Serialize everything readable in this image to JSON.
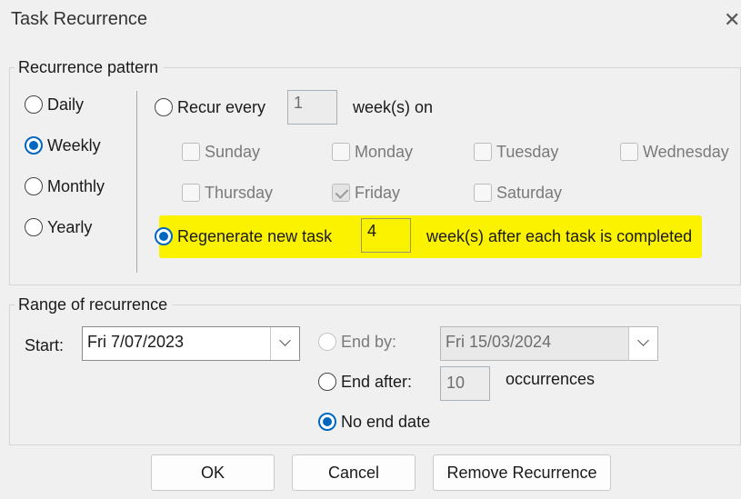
{
  "window": {
    "title": "Task Recurrence",
    "close_glyph": "✕"
  },
  "pattern": {
    "legend": "Recurrence pattern",
    "frequency_options": [
      {
        "label": "Daily",
        "checked": false
      },
      {
        "label": "Weekly",
        "checked": true
      },
      {
        "label": "Monthly",
        "checked": false
      },
      {
        "label": "Yearly",
        "checked": false
      }
    ],
    "recur_every": {
      "label": "Recur every",
      "value": "1",
      "suffix": "week(s) on",
      "checked": false
    },
    "days": [
      {
        "label": "Sunday",
        "checked": false
      },
      {
        "label": "Monday",
        "checked": false
      },
      {
        "label": "Tuesday",
        "checked": false
      },
      {
        "label": "Wednesday",
        "checked": false
      },
      {
        "label": "Thursday",
        "checked": false
      },
      {
        "label": "Friday",
        "checked": true
      },
      {
        "label": "Saturday",
        "checked": false
      }
    ],
    "regenerate": {
      "label": "Regenerate new task",
      "value": "4",
      "suffix": "week(s) after each task is completed",
      "checked": true,
      "highlight_color": "#fbf200"
    }
  },
  "range": {
    "legend": "Range of recurrence",
    "start_label": "Start:",
    "start_value": "Fri 7/07/2023",
    "end_by": {
      "label": "End by:",
      "value": "Fri 15/03/2024",
      "enabled": false
    },
    "end_after": {
      "label": "End after:",
      "value": "10",
      "suffix": "occurrences"
    },
    "no_end": {
      "label": "No end date",
      "checked": true
    }
  },
  "buttons": {
    "ok": "OK",
    "cancel": "Cancel",
    "remove": "Remove Recurrence"
  },
  "colors": {
    "accent": "#0067c0",
    "background": "#f0f0f0"
  }
}
